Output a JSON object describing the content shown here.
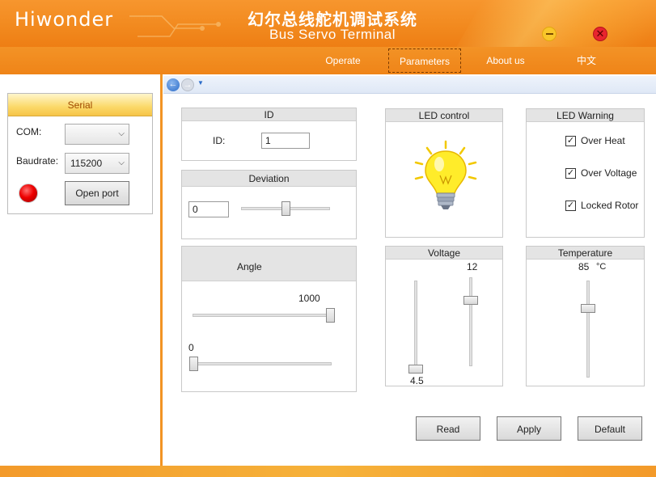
{
  "app": {
    "logo": "Hiwonder",
    "title_cn": "幻尔总线舵机调试系统",
    "title_en": "Bus Servo Terminal"
  },
  "window": {
    "minimize_glyph": "—",
    "close_glyph": "✕"
  },
  "nav": {
    "items": [
      {
        "label": "Operate"
      },
      {
        "label": "Parameters"
      },
      {
        "label": "About us"
      },
      {
        "label": "中文"
      }
    ],
    "active": "Parameters"
  },
  "serial": {
    "title": "Serial",
    "com_label": "COM:",
    "com_value": "",
    "baud_label": "Baudrate:",
    "baud_value": "115200",
    "open_button": "Open port",
    "status_color": "#e00000"
  },
  "id_panel": {
    "title": "ID",
    "label": "ID:",
    "value": "1"
  },
  "deviation_panel": {
    "title": "Deviation",
    "value": "0",
    "slider_fraction": 0.5
  },
  "angle_panel": {
    "title": "Angle",
    "max_value": "1000",
    "min_value": "0",
    "upper_slider_fraction": 1.0,
    "lower_slider_fraction": 0.0
  },
  "led_control": {
    "title": "LED control",
    "icon": "light-bulb-icon"
  },
  "led_warning": {
    "title": "LED Warning",
    "items": [
      {
        "label": "Over Heat",
        "checked": "✓"
      },
      {
        "label": "Over Voltage",
        "checked": "✓"
      },
      {
        "label": "Locked Rotor",
        "checked": "✓"
      }
    ]
  },
  "voltage": {
    "title": "Voltage",
    "max_value": "12",
    "min_value": "4.5"
  },
  "temperature": {
    "title": "Temperature",
    "value": "85",
    "unit": "°C"
  },
  "actions": {
    "read": "Read",
    "apply": "Apply",
    "default": "Default"
  },
  "colors": {
    "accent": "#f28a1f",
    "nav_active_border": "#7a3a00",
    "serial_title": "#a04a00"
  }
}
